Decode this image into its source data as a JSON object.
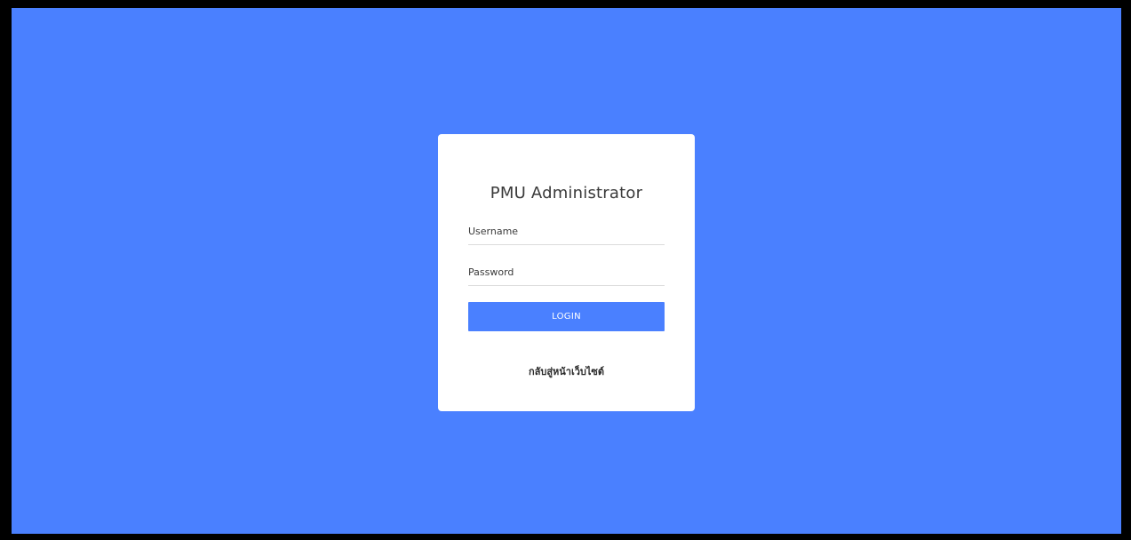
{
  "login": {
    "title": "PMU Administrator",
    "username_placeholder": "Username",
    "username_value": "",
    "password_placeholder": "Password",
    "password_value": "",
    "login_label": "LOGIN",
    "back_link_label": "กลับสู่หน้าเว็บไซต์"
  },
  "colors": {
    "background": "#4a80ff",
    "accent": "#4a80ff",
    "card": "#ffffff"
  }
}
